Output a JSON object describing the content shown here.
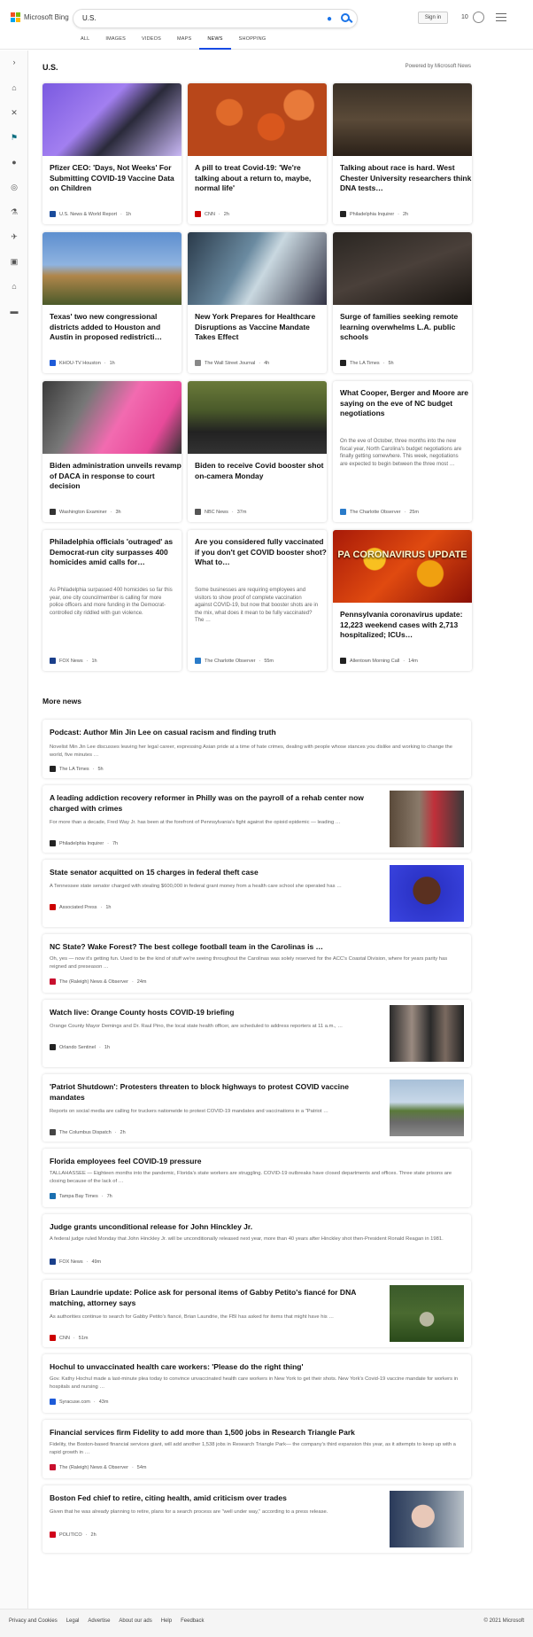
{
  "header": {
    "brand": "Microsoft Bing",
    "query": "U.S.",
    "signin": "Sign in",
    "points": "10"
  },
  "tabs": [
    "ALL",
    "IMAGES",
    "VIDEOS",
    "MAPS",
    "NEWS",
    "SHOPPING"
  ],
  "section": {
    "title": "U.S.",
    "powered": "Powered by Microsoft News"
  },
  "cards": [
    {
      "title": "Pfizer CEO: 'Days, Not Weeks' For Submitting COVID-19 Vaccine Data on Children",
      "source": "U.S. News & World Report",
      "time": "1h",
      "color": "#1a4b9b"
    },
    {
      "title": "A pill to treat Covid-19: 'We're talking about a return to, maybe, normal life'",
      "source": "CNN",
      "time": "2h",
      "color": "#cc0000"
    },
    {
      "title": "Talking about race is hard. West Chester University researchers think DNA tests…",
      "source": "Philadelphia Inquirer",
      "time": "2h",
      "color": "#222222"
    },
    {
      "title": "Texas' two new congressional districts added to Houston and Austin in proposed redistricti…",
      "source": "KHOU-TV Houston",
      "time": "1h",
      "color": "#1e5bd8"
    },
    {
      "title": "New York Prepares for Healthcare Disruptions as Vaccine Mandate Takes Effect",
      "source": "The Wall Street Journal",
      "time": "4h",
      "color": "#888888"
    },
    {
      "title": "Surge of families seeking remote learning overwhelms L.A. public schools",
      "source": "The LA Times",
      "time": "5h",
      "color": "#222222"
    },
    {
      "title": "Biden administration unveils revamp of DACA in response to court decision",
      "source": "Washington Examiner",
      "time": "3h",
      "color": "#333333"
    },
    {
      "title": "Biden to receive Covid booster shot on-camera Monday",
      "source": "NBC News",
      "time": "37m",
      "color": "#555555"
    },
    {
      "title": "What Cooper, Berger and Moore are saying on the eve of NC budget negotiations",
      "desc": "On the eve of October, three months into the new fiscal year, North Carolina's budget negotiations are finally getting somewhere. This week, negotiations are expected to begin between the three most …",
      "source": "The Charlotte Observer",
      "time": "25m",
      "color": "#2a7bc9"
    },
    {
      "title": "Philadelphia officials 'outraged' as Democrat-run city surpasses 400 homicides amid calls for…",
      "desc": "As Philadelphia surpassed 400 homicides so far this year, one city councilmember is calling for more police officers and more funding in the Democrat-controlled city riddled with gun violence.",
      "source": "FOX News",
      "time": "1h",
      "color": "#1a3f8b"
    },
    {
      "title": "Are you considered fully vaccinated if you don't get COVID booster shot? What to…",
      "desc": "Some businesses are requiring employees and visitors to show proof of complete vaccination against COVID-19, but now that booster shots are in the mix, what does it mean to be fully vaccinated? The …",
      "source": "The Charlotte Observer",
      "time": "55m",
      "color": "#2a7bc9"
    },
    {
      "title": "Pennsylvania coronavirus update: 12,223 weekend cases with 2,713 hospitalized; ICUs…",
      "source": "Allentown Morning Call",
      "time": "14m",
      "color": "#222222",
      "overlay": "PA CORONAVIRUS UPDATE"
    }
  ],
  "more_title": "More news",
  "more": [
    {
      "title": "Podcast: Author Min Jin Lee on casual racism and finding truth",
      "desc": "Novelist Min Jin Lee discusses leaving her legal career, expressing Asian pride at a time of hate crimes, dealing with people whose stances you dislike and working to change the world, five minutes …",
      "source": "The LA Times",
      "time": "5h",
      "color": "#222222"
    },
    {
      "title": "A leading addiction recovery reformer in Philly was on the payroll of a rehab center now charged with crimes",
      "desc": "For more than a decade, Fred Way Jr. has been at the forefront of Pennsylvania's fight against the opioid epidemic — leading …",
      "source": "Philadelphia Inquirer",
      "time": "7h",
      "color": "#222222"
    },
    {
      "title": "State senator acquitted on 15 charges in federal theft case",
      "desc": "A Tennessee state senator charged with stealing $600,000 in federal grant money from a health care school she operated has …",
      "source": "Associated Press",
      "time": "1h",
      "color": "#cc0000"
    },
    {
      "title": "NC State? Wake Forest? The best college football team in the Carolinas is …",
      "desc": "Oh, yes — now it's getting fun. Used to be the kind of stuff we're seeing throughout the Carolinas was solely reserved for the ACC's Coastal Division, where for years parity has reigned and preseason …",
      "source": "The (Raleigh) News & Observer",
      "time": "24m",
      "color": "#c8102e"
    },
    {
      "title": "Watch live: Orange County hosts COVID-19 briefing",
      "desc": "Orange County Mayor Demings and Dr. Raul Pino, the local state health officer, are scheduled to address reporters at 11 a.m., …",
      "source": "Orlando Sentinel",
      "time": "1h",
      "color": "#222222"
    },
    {
      "title": "'Patriot Shutdown': Protesters threaten to block highways to protest COVID vaccine mandates",
      "desc": "Reports on social media are calling for truckers nationwide to protest COVID-19 mandates and vaccinations in a \"Patriot …",
      "source": "The Columbus Dispatch",
      "time": "2h",
      "color": "#444444"
    },
    {
      "title": "Florida employees feel COVID-19 pressure",
      "desc": "TALLAHASSEE — Eighteen months into the pandemic, Florida's state workers are struggling. COVID-19 outbreaks have closed departments and offices. Three state prisons are closing because of the lack of …",
      "source": "Tampa Bay Times",
      "time": "7h",
      "color": "#1a6fb0"
    },
    {
      "title": "Judge grants unconditional release for John Hinckley Jr.",
      "desc": "A federal judge ruled Monday that John Hinckley Jr. will be unconditionally released next year, more than 40 years after Hinckley shot then-President Ronald Reagan in 1981.",
      "source": "FOX News",
      "time": "49m",
      "color": "#1a3f8b"
    },
    {
      "title": "Brian Laundrie update: Police ask for personal items of Gabby Petito's fiancé for DNA matching, attorney says",
      "desc": "As authorities continue to search for Gabby Petito's fiancé, Brian Laundrie, the FBI has asked for items that might have his …",
      "source": "CNN",
      "time": "51m",
      "color": "#cc0000"
    },
    {
      "title": "Hochul to unvaccinated health care workers: 'Please do the right thing'",
      "desc": "Gov. Kathy Hochul made a last-minute plea today to convince unvaccinated health care workers in New York to get their shots. New York's Covid-19 vaccine mandate for workers in hospitals and nursing …",
      "source": "Syracuse.com",
      "time": "43m",
      "color": "#1e5bd8"
    },
    {
      "title": "Financial services firm Fidelity to add more than 1,500 jobs in Research Triangle Park",
      "desc": "Fidelity, the Boston-based financial services giant, will add another 1,538 jobs in Research Triangle Park— the company's third expansion this year, as it attempts to keep up with a rapid growth in …",
      "source": "The (Raleigh) News & Observer",
      "time": "54m",
      "color": "#c8102e"
    },
    {
      "title": "Boston Fed chief to retire, citing health, amid criticism over trades",
      "desc": "Given that he was already planning to retire, plans for a search process are \"well under way,\" according to a press release.",
      "source": "POLITICO",
      "time": "2h",
      "color": "#d0021b"
    }
  ],
  "footer": {
    "links": [
      "Privacy and Cookies",
      "Legal",
      "Advertise",
      "About our ads",
      "Help",
      "Feedback"
    ],
    "copyright": "© 2021 Microsoft"
  }
}
